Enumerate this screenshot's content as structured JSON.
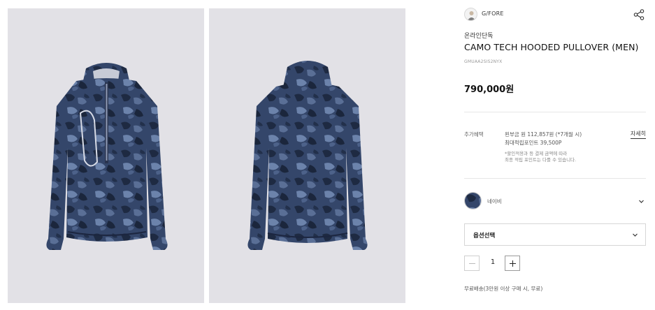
{
  "brand": {
    "name": "G/FORE",
    "logo_icon": "brand-logo-icon"
  },
  "product": {
    "badge": "온라인단독",
    "title": "CAMO TECH HOODED PULLOVER (MEN)",
    "code": "GMUAA2SIS2NYX",
    "price": "790,000원"
  },
  "benefits": {
    "label": "추가혜택",
    "line1": "왼부금 원 112,857원 (*7개월 시)",
    "line2": "최대적립포인트 39,500P",
    "note1": "*할인적용과 등 결제 금액에 따라",
    "note2": "최종 적립 포인트는 다를 수 있습니다.",
    "detail_link": "자세히"
  },
  "color_option": {
    "name": "네이비",
    "swatch_color": "#3d4f6e"
  },
  "option_select": {
    "placeholder": "옵션선택"
  },
  "quantity": {
    "value": "1"
  },
  "shipping": "무료배송(3만원 이상 구매 시, 무료)",
  "images": [
    {
      "view": "front",
      "bg": "#e2e1e6",
      "garment_color": "#34466a"
    },
    {
      "view": "back",
      "bg": "#e2e1e6",
      "garment_color": "#34466a"
    }
  ],
  "colors": {
    "accent": "#111111",
    "border": "#d6d6d6",
    "panel_bg": "#e2e1e6"
  }
}
